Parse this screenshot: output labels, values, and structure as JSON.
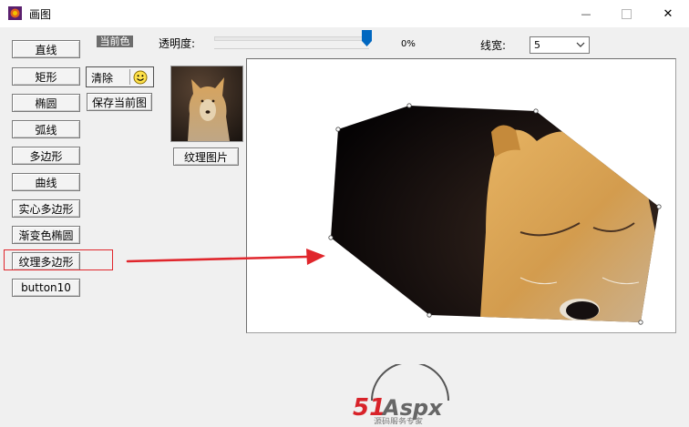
{
  "window": {
    "title": "画图",
    "controls": {
      "minimize": "—",
      "maximize": "",
      "close": "✕"
    }
  },
  "toolbar": {
    "current_color_label": "当前色",
    "opacity_label": "透明度:",
    "opacity_value": "0%",
    "opacity_level": 1.0,
    "linewidth_label": "线宽:",
    "linewidth_value": "5"
  },
  "left_buttons": [
    {
      "label": "直线"
    },
    {
      "label": "矩形"
    },
    {
      "label": "椭圆"
    },
    {
      "label": "弧线"
    },
    {
      "label": "多边形"
    },
    {
      "label": "曲线"
    },
    {
      "label": "实心多边形"
    },
    {
      "label": "渐变色椭圆"
    },
    {
      "label": "纹理多边形"
    },
    {
      "label": "button10"
    }
  ],
  "selected_tool": "纹理多边形",
  "actions": {
    "clear_label": "清除",
    "save_label": "保存当前图",
    "texture_label": "纹理图片"
  },
  "logo": {
    "text": "51Aspx",
    "subtitle": "源码服务专家"
  },
  "colors": {
    "accent_red": "#e0262c",
    "selection_gray": "#6d6d6d",
    "slider_blue": "#0067c0"
  }
}
